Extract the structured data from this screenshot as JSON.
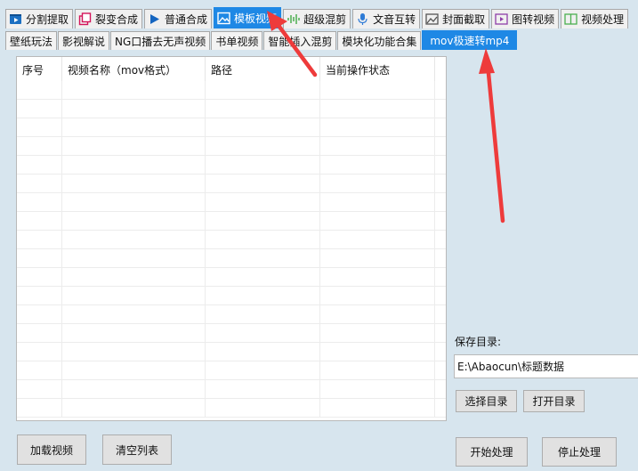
{
  "top_tabs": [
    {
      "label": "分割提取",
      "icon": "film-play-icon"
    },
    {
      "label": "裂变合成",
      "icon": "copy-squares-icon"
    },
    {
      "label": "普通合成",
      "icon": "play-triangle-icon"
    },
    {
      "label": "模板视频",
      "icon": "template-image-icon"
    },
    {
      "label": "超级混剪",
      "icon": "audio-wave-icon"
    },
    {
      "label": "文音互转",
      "icon": "microphone-icon"
    },
    {
      "label": "封面截取",
      "icon": "picture-icon"
    },
    {
      "label": "图转视频",
      "icon": "image-video-icon"
    },
    {
      "label": "视频处理",
      "icon": "split-panel-icon"
    }
  ],
  "active_top_tab": "模板视频",
  "sub_tabs": [
    "壁纸玩法",
    "影视解说",
    "NG口播去无声视频",
    "书单视频",
    "智能插入混剪",
    "模块化功能合集",
    "mov极速转mp4"
  ],
  "sub_tab_partial_hidden": "智能",
  "active_sub_tab": "mov极速转mp4",
  "table": {
    "columns": [
      "序号",
      "视频名称（mov格式）",
      "路径",
      "当前操作状态"
    ],
    "rows": []
  },
  "save": {
    "label": "保存目录:",
    "value": "E:\\Abaocun\\标题数据",
    "choose_label": "选择目录",
    "open_label": "打开目录"
  },
  "actions": {
    "load_label": "加载视频",
    "clear_label": "清空列表",
    "start_label": "开始处理",
    "stop_label": "停止处理"
  },
  "colors": {
    "background": "#d7e5ee",
    "active_tab": "#1e88e5",
    "annotation_arrow": "#ee3b3b"
  }
}
